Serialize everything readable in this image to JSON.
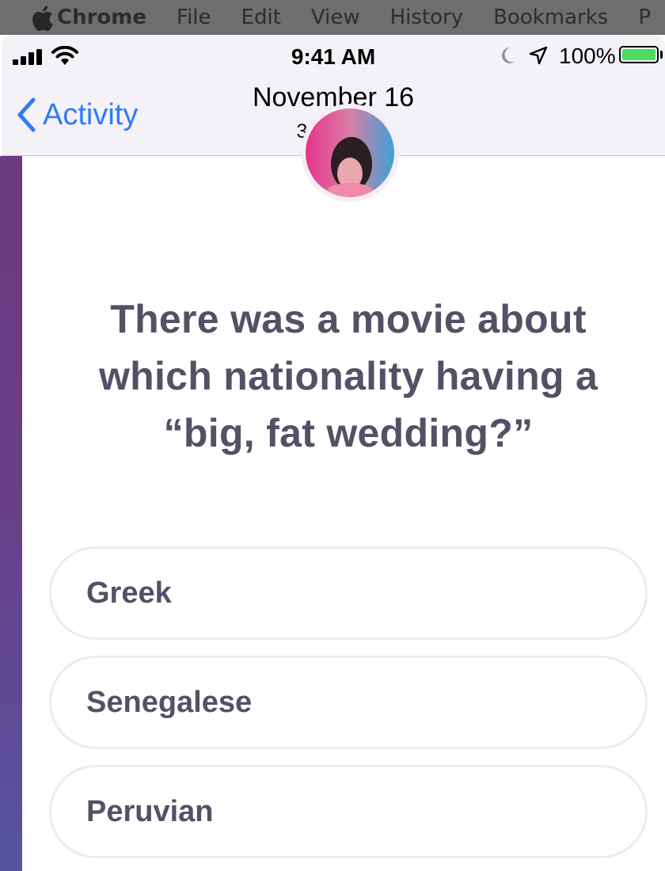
{
  "menubar": {
    "app": "Chrome",
    "items": [
      "File",
      "Edit",
      "View",
      "History",
      "Bookmarks",
      "P"
    ]
  },
  "status_bar": {
    "time": "9:41 AM",
    "battery": "100%"
  },
  "nav": {
    "back_label": "Activity",
    "title": "November 16",
    "subtitle": "3:37 PM"
  },
  "quiz": {
    "question": "There was a movie about which nationality having a “big, fat wedding?”",
    "answers": [
      "Greek",
      "Senegalese",
      "Peruvian"
    ]
  },
  "colors": {
    "accent": "#2f7cf6",
    "text": "#535166",
    "battery": "#4cd964"
  }
}
